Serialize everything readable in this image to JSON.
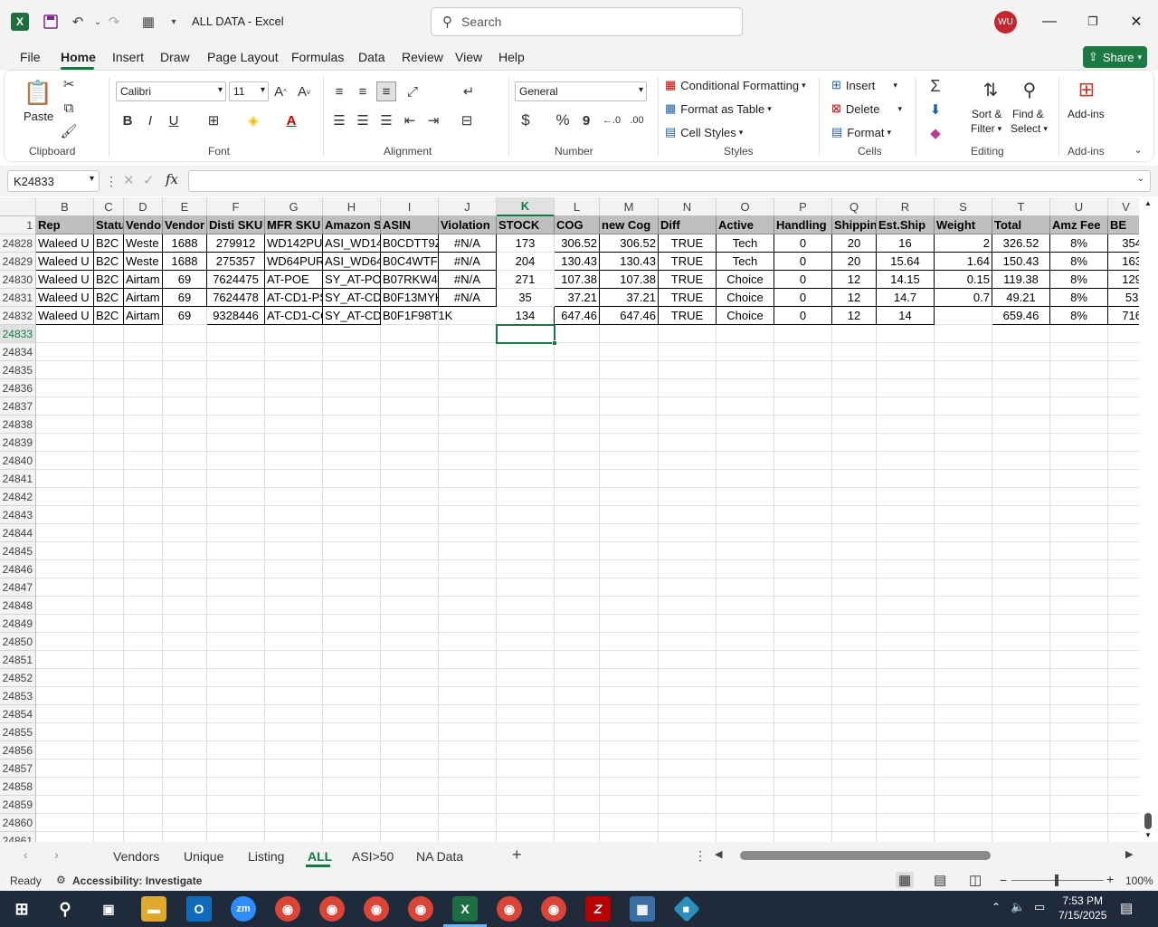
{
  "app": {
    "title": "ALL DATA  -  Excel",
    "search_placeholder": "Search",
    "user_initials": "WU"
  },
  "menu": [
    "File",
    "Home",
    "Insert",
    "Draw",
    "Page Layout",
    "Formulas",
    "Data",
    "Review",
    "View",
    "Help"
  ],
  "share_label": "Share",
  "ribbon": {
    "clipboard": {
      "label": "Clipboard",
      "paste": "Paste"
    },
    "font": {
      "label": "Font",
      "family": "Calibri",
      "size": "11",
      "bold": "B",
      "italic": "I",
      "underline": "U"
    },
    "alignment": {
      "label": "Alignment"
    },
    "number": {
      "label": "Number",
      "format": "General",
      "currency": "$",
      "percent": "%",
      "comma": "9"
    },
    "styles": {
      "label": "Styles",
      "conditional": "Conditional Formatting",
      "format_table": "Format as Table",
      "cell_styles": "Cell Styles"
    },
    "cells": {
      "label": "Cells",
      "insert": "Insert",
      "delete": "Delete",
      "format": "Format"
    },
    "editing": {
      "label": "Editing",
      "sort1": "Sort &",
      "sort2": "Filter",
      "find1": "Find &",
      "find2": "Select"
    },
    "addins": {
      "label": "Add-ins",
      "btn": "Add-ins"
    }
  },
  "formula_bar": {
    "name_box": "K24833",
    "fx": "fx",
    "value": ""
  },
  "columns": [
    "B",
    "C",
    "D",
    "E",
    "F",
    "G",
    "H",
    "I",
    "J",
    "K",
    "L",
    "M",
    "N",
    "O",
    "P",
    "Q",
    "R",
    "S",
    "T",
    "U",
    "V"
  ],
  "header_row_number": "1",
  "headers": [
    "Rep",
    "Statu",
    "Vendo",
    "Vendor",
    "Disti SKU",
    "MFR SKU",
    "Amazon S",
    "ASIN",
    "Violation",
    "STOCK",
    "COG",
    "new Cog",
    "Diff",
    "Active",
    "Handling",
    "Shippin",
    "Est.Ship",
    "Weight",
    "Total",
    "Amz Fee",
    "BE"
  ],
  "data_rows": [
    {
      "num": "24828",
      "cells": [
        "Waleed U",
        "B2C",
        "Weste",
        "1688",
        "279912",
        "WD142PU",
        "ASI_WD14",
        "B0CDTT9Z",
        "#N/A",
        "173",
        "306.52",
        "306.52",
        "TRUE",
        "Tech",
        "0",
        "20",
        "16",
        "2",
        "326.52",
        "8%",
        "354"
      ]
    },
    {
      "num": "24829",
      "cells": [
        "Waleed U",
        "B2C",
        "Weste",
        "1688",
        "275357",
        "WD64PUR",
        "ASI_WD64",
        "B0C4WTF5",
        "#N/A",
        "204",
        "130.43",
        "130.43",
        "TRUE",
        "Tech",
        "0",
        "20",
        "15.64",
        "1.64",
        "150.43",
        "8%",
        "163"
      ]
    },
    {
      "num": "24830",
      "cells": [
        "Waleed U",
        "B2C",
        "Airtam",
        "69",
        "7624475",
        "AT-POE",
        "SY_AT-PO",
        "B07RKW43",
        "#N/A",
        "271",
        "107.38",
        "107.38",
        "TRUE",
        "Choice",
        "0",
        "12",
        "14.15",
        "0.15",
        "119.38",
        "8%",
        "129"
      ]
    },
    {
      "num": "24831",
      "cells": [
        "Waleed U",
        "B2C",
        "Airtam",
        "69",
        "7624478",
        "AT-CD1-PS",
        "SY_AT-CD:",
        "B0F13MYH",
        "#N/A",
        "35",
        "37.21",
        "37.21",
        "TRUE",
        "Choice",
        "0",
        "12",
        "14.7",
        "0.7",
        "49.21",
        "8%",
        "53."
      ]
    },
    {
      "num": "24832",
      "cells": [
        "Waleed U",
        "B2C",
        "Airtam",
        "69",
        "9328446",
        "AT-CD1-CC",
        "SY_AT-CD:",
        "B0F1F98T1K",
        "",
        "134",
        "647.46",
        "647.46",
        "TRUE",
        "Choice",
        "0",
        "12",
        "14",
        "",
        "659.46",
        "8%",
        "716"
      ]
    }
  ],
  "empty_rows": [
    "24833",
    "24834",
    "24835",
    "24836",
    "24837",
    "24838",
    "24839",
    "24840",
    "24841",
    "24842",
    "24843",
    "24844",
    "24845",
    "24846",
    "24847",
    "24848",
    "24849",
    "24850",
    "24851",
    "24852",
    "24853",
    "24854",
    "24855",
    "24856",
    "24857",
    "24858",
    "24859",
    "24860",
    "24861"
  ],
  "sheets": [
    "Vendors",
    "Unique",
    "Listing",
    "ALL",
    "ASI>50",
    "NA Data"
  ],
  "active_sheet": "ALL",
  "status": {
    "ready": "Ready",
    "accessibility": "Accessibility: Investigate",
    "zoom": "100%"
  },
  "clock": {
    "time": "7:53 PM",
    "date": "7/15/2025"
  },
  "colors": {
    "accent": "#107c41",
    "header_fill": "#bfbfbf",
    "share": "#1b7a43"
  }
}
